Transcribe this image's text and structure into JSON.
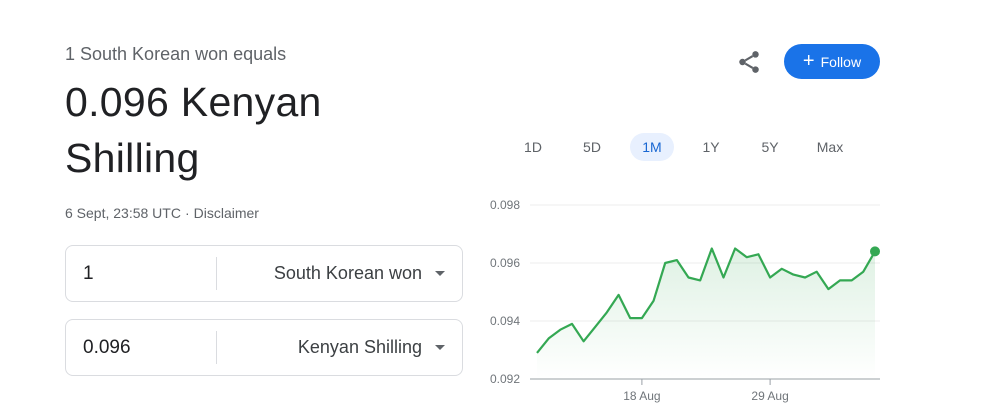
{
  "header": {
    "subtitle": "1 South Korean won equals",
    "rate_line1": "0.096 Kenyan",
    "rate_line2": "Shilling",
    "timestamp": "6 Sept, 23:58 UTC",
    "separator": "·",
    "disclaimer": "Disclaimer"
  },
  "actions": {
    "share_icon": "share-icon",
    "follow_label": "Follow",
    "follow_plus": "+"
  },
  "converter": {
    "from": {
      "amount": "1",
      "currency": "South Korean won"
    },
    "to": {
      "amount": "0.096",
      "currency": "Kenyan Shilling"
    }
  },
  "ranges": [
    "1D",
    "5D",
    "1M",
    "1Y",
    "5Y",
    "Max"
  ],
  "selected_range": "1M",
  "colors": {
    "accent": "#1a73e8",
    "line": "#34a853",
    "text": "#202124",
    "muted": "#5f6368"
  },
  "chart_data": {
    "type": "line",
    "title": "",
    "xlabel": "",
    "ylabel": "",
    "ylim": [
      0.092,
      0.098
    ],
    "yticks": [
      "0.098",
      "0.096",
      "0.094",
      "0.092"
    ],
    "xticks": [
      {
        "label": "18 Aug",
        "index": 9
      },
      {
        "label": "29 Aug",
        "index": 20
      }
    ],
    "series": [
      {
        "values": [
          0.0929,
          0.0934,
          0.0937,
          0.0939,
          0.0933,
          0.0938,
          0.0943,
          0.0949,
          0.0941,
          0.0941,
          0.0947,
          0.096,
          0.0961,
          0.0955,
          0.0954,
          0.0965,
          0.0955,
          0.0965,
          0.0962,
          0.0963,
          0.0955,
          0.0958,
          0.0956,
          0.0955,
          0.0957,
          0.0951,
          0.0954,
          0.0954,
          0.0957,
          0.0964
        ]
      }
    ]
  }
}
